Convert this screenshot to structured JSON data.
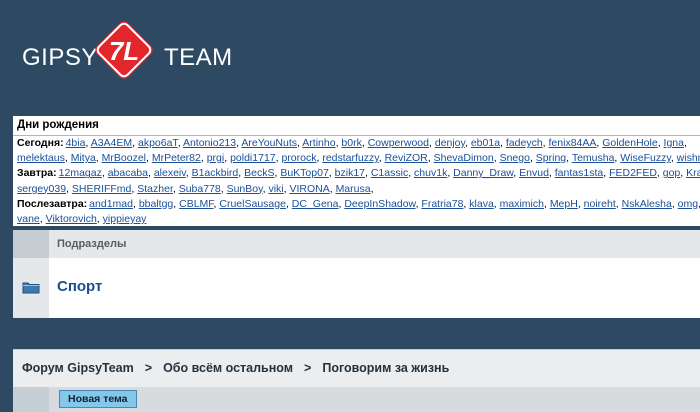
{
  "logo": {
    "word1": "GIPSY",
    "mark": "7L",
    "word2": "TEAM",
    "color": "#e2262b"
  },
  "birthdays": {
    "title": "Дни рождения",
    "lines": [
      {
        "label": "Сегодня:",
        "names": [
          "4bia",
          "A3A4EM",
          "akpo6aT",
          "Antonio213",
          "AreYouNuts",
          "Artinho",
          "b0rk",
          "Cowperwood",
          "denjoy",
          "eb01a",
          "fadeych",
          "fenix84AA",
          "GoldenHole",
          "Igna"
        ]
      },
      {
        "label": "",
        "names": [
          "melektaus",
          "Mitya",
          "MrBoozel",
          "MrPeter82",
          "prgi",
          "poldi1717",
          "prorock",
          "redstarfuzzy",
          "ReviZOR",
          "ShevaDimon",
          "Snego",
          "Spring",
          "Temusha",
          "WiseFuzzy",
          "wishm"
        ]
      },
      {
        "label": "Завтра:",
        "names": [
          "12magaz",
          "abacaba",
          "alexeiv",
          "B1ackbird",
          "BeckS",
          "BuKTop07",
          "bzik17",
          "C1assic",
          "chuv1k",
          "Danny_Draw",
          "Envud",
          "fantas1sta",
          "FED2FED",
          "gop",
          "Kra"
        ]
      },
      {
        "label": "",
        "names": [
          "sergey039",
          "SHERIFFmd",
          "Stazher",
          "Suba778",
          "SunBoy",
          "viki",
          "VIRONA",
          "Marusa"
        ]
      },
      {
        "label": "Послезавтра:",
        "names": [
          "and1mad",
          "bbaltgg",
          "CBLMF",
          "CruelSausage",
          "DC_Gena",
          "DeepInShadow",
          "Fratria78",
          "klava",
          "maximich",
          "MepH",
          "noireht",
          "NskAlesha",
          "omg"
        ]
      },
      {
        "label": "",
        "names": [
          "vane",
          "Viktorovich",
          "yippieyay"
        ]
      }
    ]
  },
  "subforums": {
    "header": "Подразделы",
    "items": [
      {
        "label": "Спорт"
      }
    ]
  },
  "breadcrumb": {
    "separator": ">",
    "items": [
      "Форум GipsyTeam",
      "Обо всём остальном",
      "Поговорим за жизнь"
    ]
  },
  "actions": {
    "new_topic": "Новая тема"
  }
}
